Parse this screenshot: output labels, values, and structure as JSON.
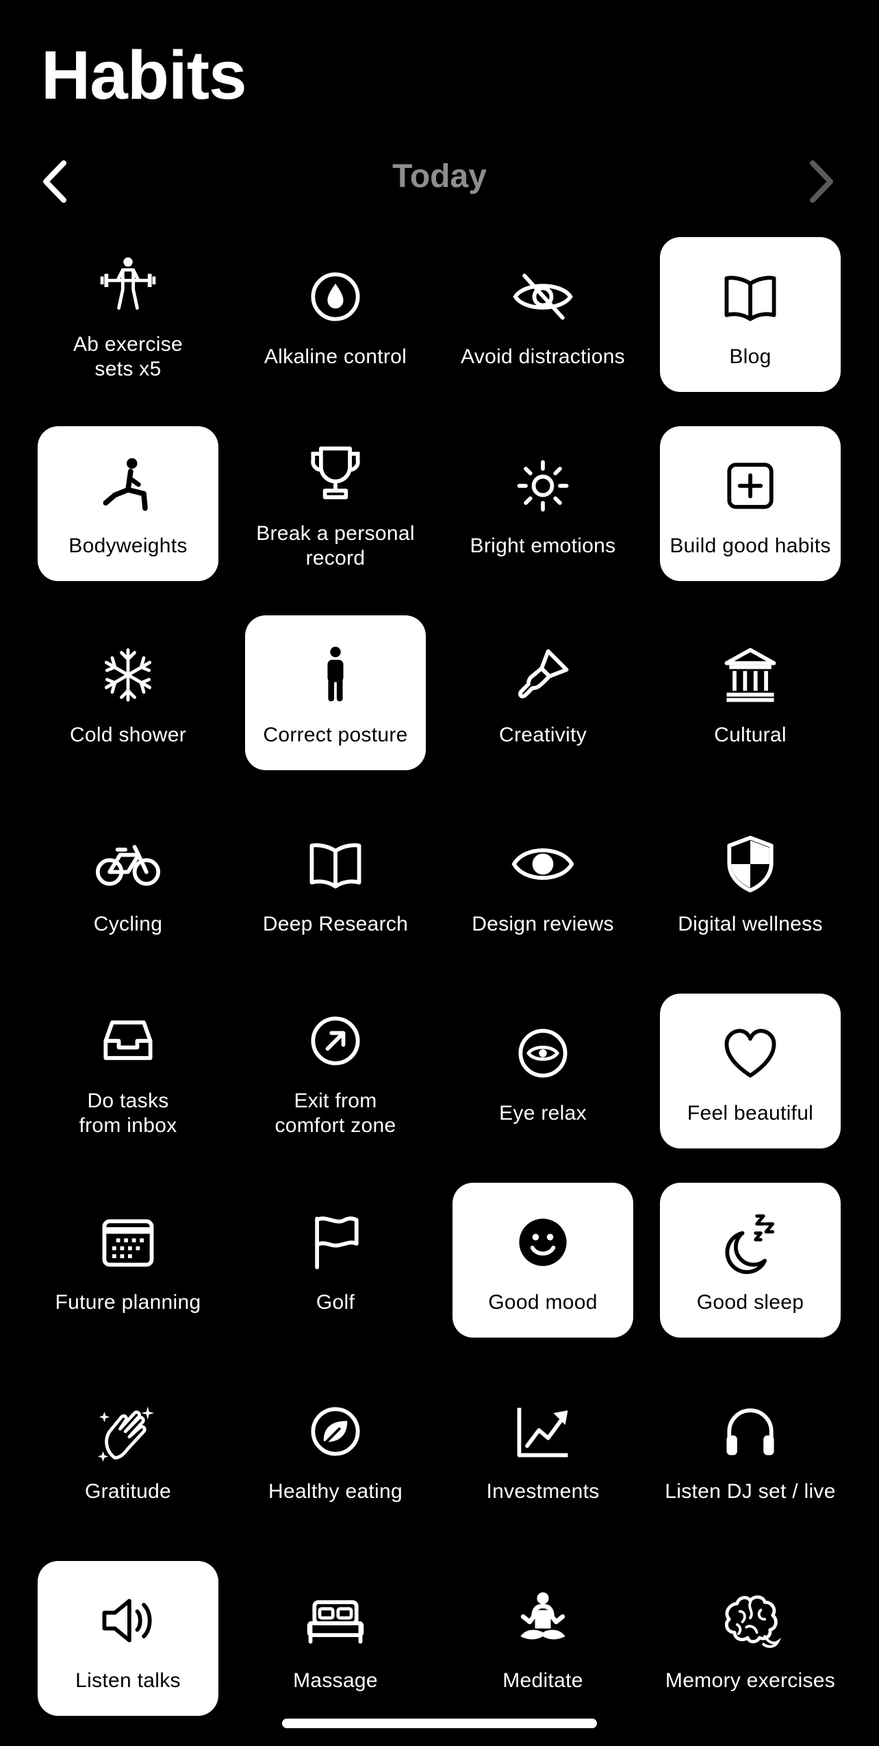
{
  "header": {
    "title": "Habits"
  },
  "nav": {
    "label": "Today",
    "prev_icon": "chevron-left-icon",
    "next_icon": "chevron-right-icon"
  },
  "colors": {
    "background": "#000000",
    "tile_selected_bg": "#FFFFFF",
    "nav_label": "#8E8E8E"
  },
  "habits": [
    {
      "label": "Ab exercise\nsets x5",
      "icon": "weightlifter",
      "selected": false
    },
    {
      "label": "Alkaline control",
      "icon": "drop",
      "selected": false
    },
    {
      "label": "Avoid distractions",
      "icon": "eye-slash",
      "selected": false
    },
    {
      "label": "Blog",
      "icon": "book",
      "selected": true
    },
    {
      "label": "Bodyweights",
      "icon": "lunge",
      "selected": true
    },
    {
      "label": "Break a personal\nrecord",
      "icon": "trophy",
      "selected": false
    },
    {
      "label": "Bright emotions",
      "icon": "sun",
      "selected": false
    },
    {
      "label": "Build good habits",
      "icon": "plus-square",
      "selected": true
    },
    {
      "label": "Cold shower",
      "icon": "snowflake",
      "selected": false
    },
    {
      "label": "Correct posture",
      "icon": "person",
      "selected": true
    },
    {
      "label": "Creativity",
      "icon": "paintbrush",
      "selected": false
    },
    {
      "label": "Cultural",
      "icon": "museum",
      "selected": false
    },
    {
      "label": "Cycling",
      "icon": "bicycle",
      "selected": false
    },
    {
      "label": "Deep Research",
      "icon": "book",
      "selected": false
    },
    {
      "label": "Design reviews",
      "icon": "eye",
      "selected": false
    },
    {
      "label": "Digital wellness",
      "icon": "shield-checkered",
      "selected": false
    },
    {
      "label": "Do tasks\nfrom inbox",
      "icon": "tray",
      "selected": false
    },
    {
      "label": "Exit from\ncomfort zone",
      "icon": "arrow-circle",
      "selected": false
    },
    {
      "label": "Eye relax",
      "icon": "eye-circle",
      "selected": false
    },
    {
      "label": "Feel beautiful",
      "icon": "heart",
      "selected": true
    },
    {
      "label": "Future planning",
      "icon": "calendar",
      "selected": false
    },
    {
      "label": "Golf",
      "icon": "flag",
      "selected": false
    },
    {
      "label": "Good mood",
      "icon": "smiley",
      "selected": true
    },
    {
      "label": "Good sleep",
      "icon": "moon-zzz",
      "selected": true
    },
    {
      "label": "Gratitude",
      "icon": "hands-clap",
      "selected": false
    },
    {
      "label": "Healthy eating",
      "icon": "leaf-circle",
      "selected": false
    },
    {
      "label": "Investments",
      "icon": "chart-up",
      "selected": false
    },
    {
      "label": "Listen DJ set / live",
      "icon": "headphones",
      "selected": false
    },
    {
      "label": "Listen talks",
      "icon": "speaker",
      "selected": true
    },
    {
      "label": "Massage",
      "icon": "bed",
      "selected": false
    },
    {
      "label": "Meditate",
      "icon": "meditate",
      "selected": false
    },
    {
      "label": "Memory exercises",
      "icon": "brain",
      "selected": false
    }
  ]
}
